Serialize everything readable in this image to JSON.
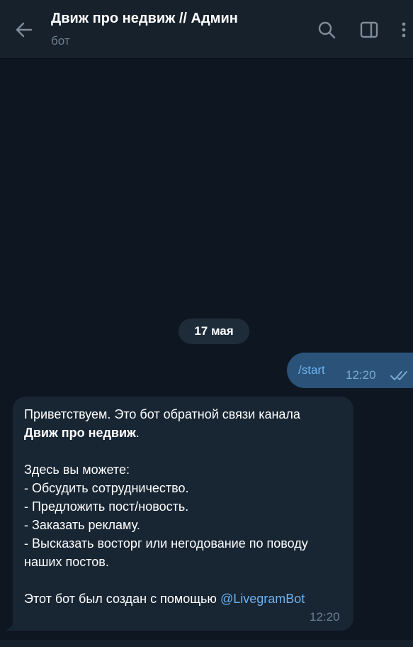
{
  "header": {
    "title": "Движ про недвиж // Админ",
    "subtitle": "бот",
    "icons": [
      "back-arrow-icon",
      "search-icon",
      "sidebar-toggle-icon",
      "more-vertical-icon"
    ]
  },
  "chat": {
    "date_separator": "17 мая",
    "outgoing": {
      "text": "/start",
      "time": "12:20",
      "status": "read"
    },
    "incoming": {
      "line1": "Приветствуем. Это бот обратной связи канала",
      "line2_bold": "Движ про недвиж",
      "line2_tail": ".",
      "line3": "Здесь вы можете:",
      "line4": "- Обсудить сотрудничество.",
      "line5": "- Предложить пост/новость.",
      "line6": "- Заказать рекламу.",
      "line7": "- Высказать восторг или негодование по поводу",
      "line8": "наших постов.",
      "line9": "Этот бот был создан с помощью",
      "mention": "@LivegramBot",
      "time": "12:20"
    }
  },
  "colors": {
    "background": "#0e1621",
    "header": "#17212b",
    "outgoing_bubble": "#2b5278",
    "incoming_bubble": "#182533",
    "link": "#6ab3f3",
    "muted": "#6d7f8f"
  }
}
